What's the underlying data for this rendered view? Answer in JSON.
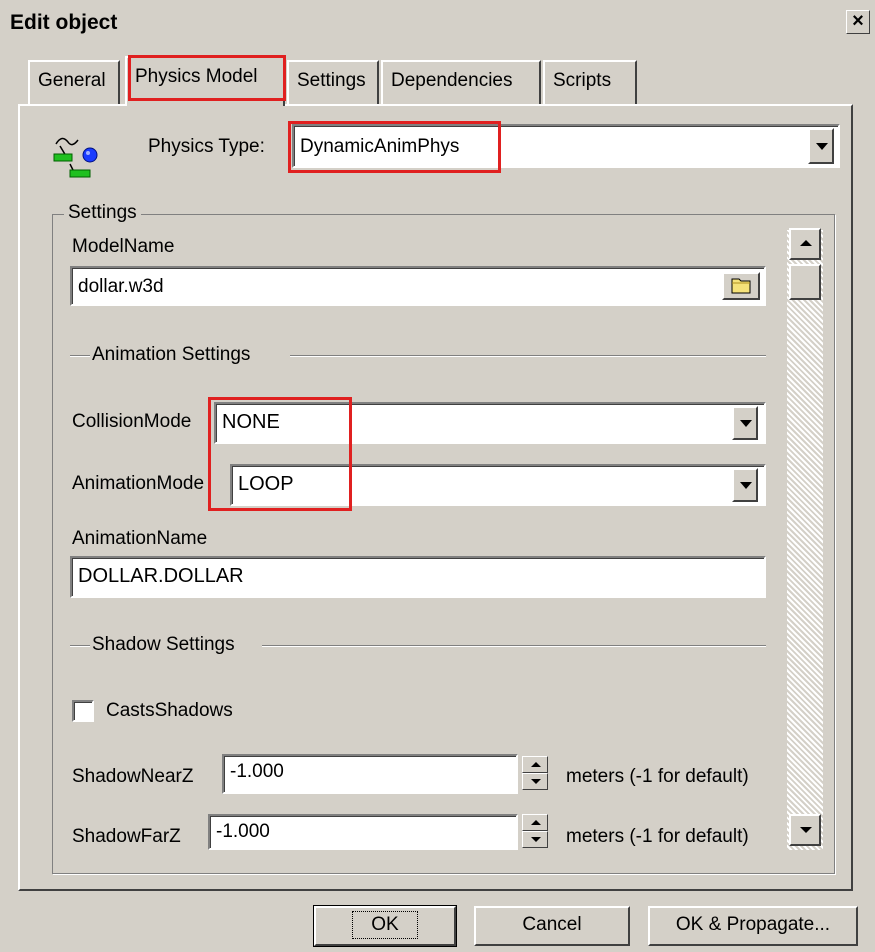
{
  "window": {
    "title": "Edit object",
    "close_glyph": "×"
  },
  "tabs": [
    {
      "label": "General"
    },
    {
      "label": "Physics Model"
    },
    {
      "label": "Settings"
    },
    {
      "label": "Dependencies"
    },
    {
      "label": "Scripts"
    }
  ],
  "physics": {
    "type_label": "Physics Type:",
    "type_value": "DynamicAnimPhys",
    "icon": "physics-model-icon"
  },
  "settings": {
    "group_label": "Settings",
    "model_name_label": "ModelName",
    "model_name_value": "dollar.w3d",
    "browse_icon": "folder-icon",
    "animation_section_label": "Animation Settings",
    "collision_mode_label": "CollisionMode",
    "collision_mode_value": "NONE",
    "animation_mode_label": "AnimationMode",
    "animation_mode_value": "LOOP",
    "animation_name_label": "AnimationName",
    "animation_name_value": "DOLLAR.DOLLAR",
    "shadow_section_label": "Shadow Settings",
    "casts_shadows_label": "CastsShadows",
    "casts_shadows_checked": false,
    "shadow_near_label": "ShadowNearZ",
    "shadow_near_value": "-1.000",
    "shadow_near_unit": "meters (-1 for default)",
    "shadow_far_label": "ShadowFarZ",
    "shadow_far_value": "-1.000",
    "shadow_far_unit": "meters (-1 for default)"
  },
  "buttons": {
    "ok": "OK",
    "cancel": "Cancel",
    "ok_propagate": "OK & Propagate..."
  },
  "colors": {
    "highlight_box": "#e02020",
    "dialog_face": "#d4d0c8"
  }
}
